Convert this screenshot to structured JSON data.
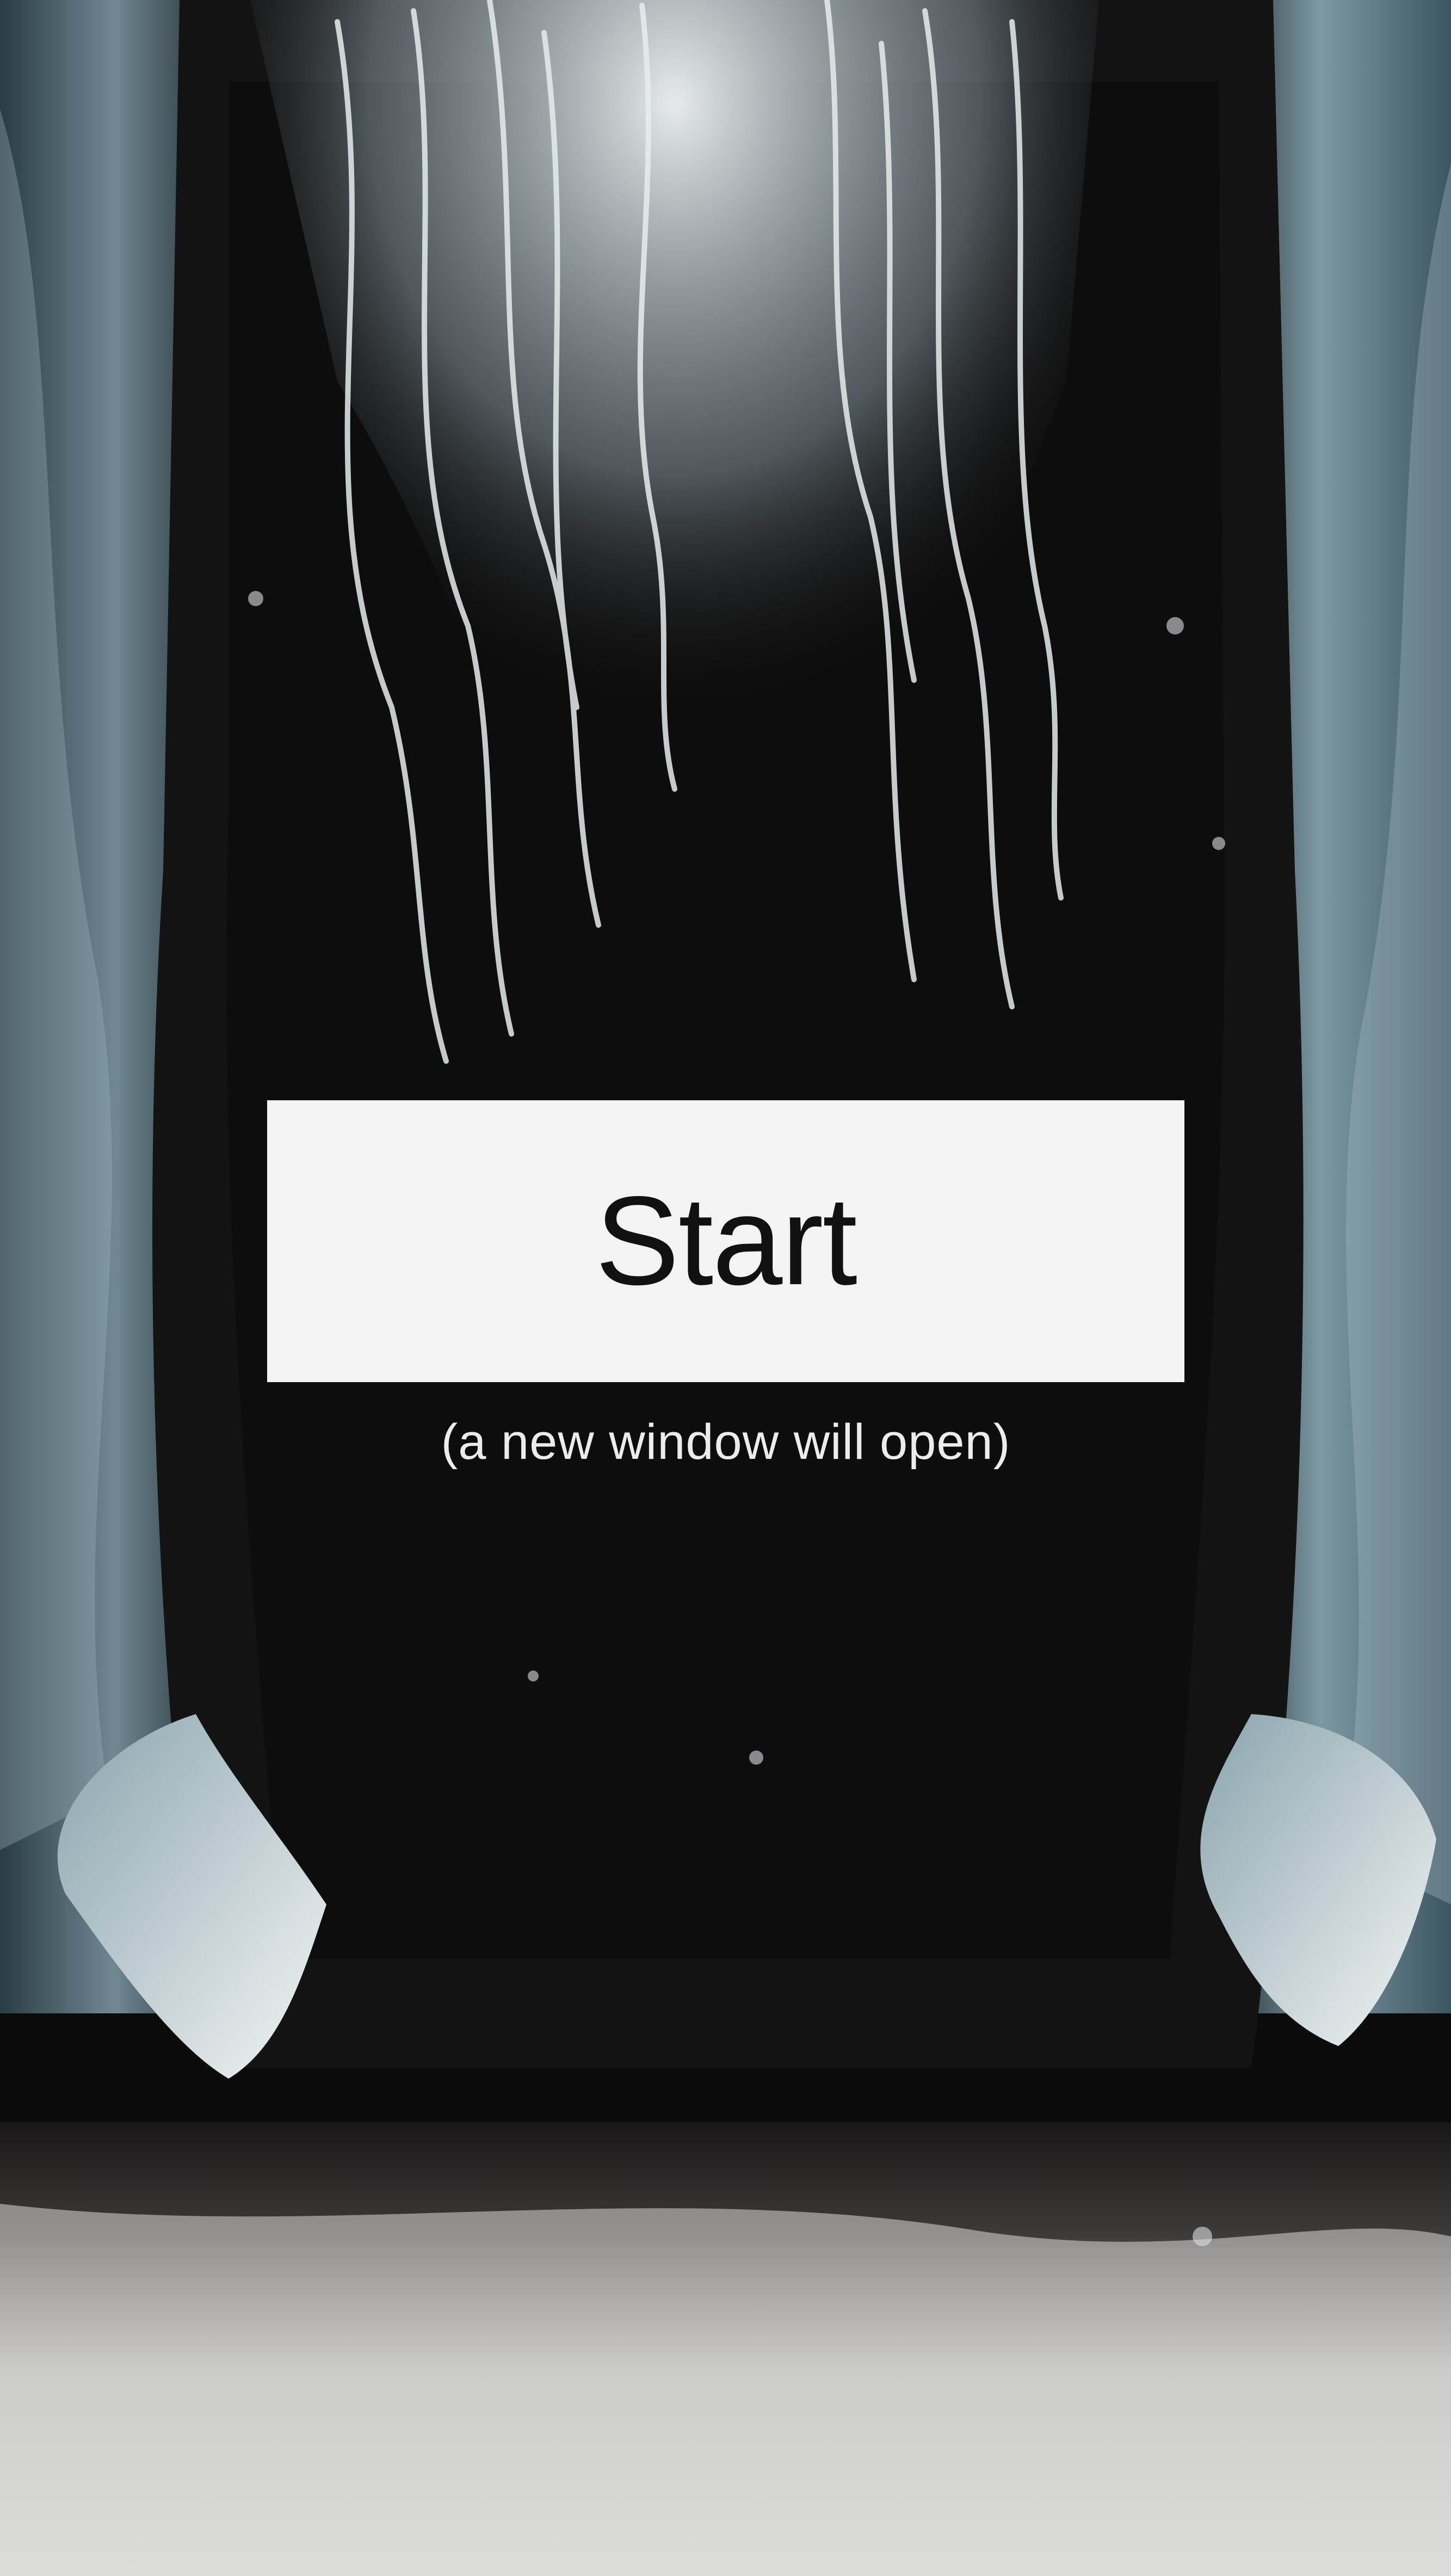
{
  "start_screen": {
    "button_label": "Start",
    "hint": "(a new window will open)"
  },
  "background": {
    "description_icon": "spectral-figure-artwork",
    "colors": {
      "dark": "#0c0b0b",
      "water": "#3e5560",
      "glow": "#e8eef0",
      "button": "#f3f3f3"
    }
  }
}
